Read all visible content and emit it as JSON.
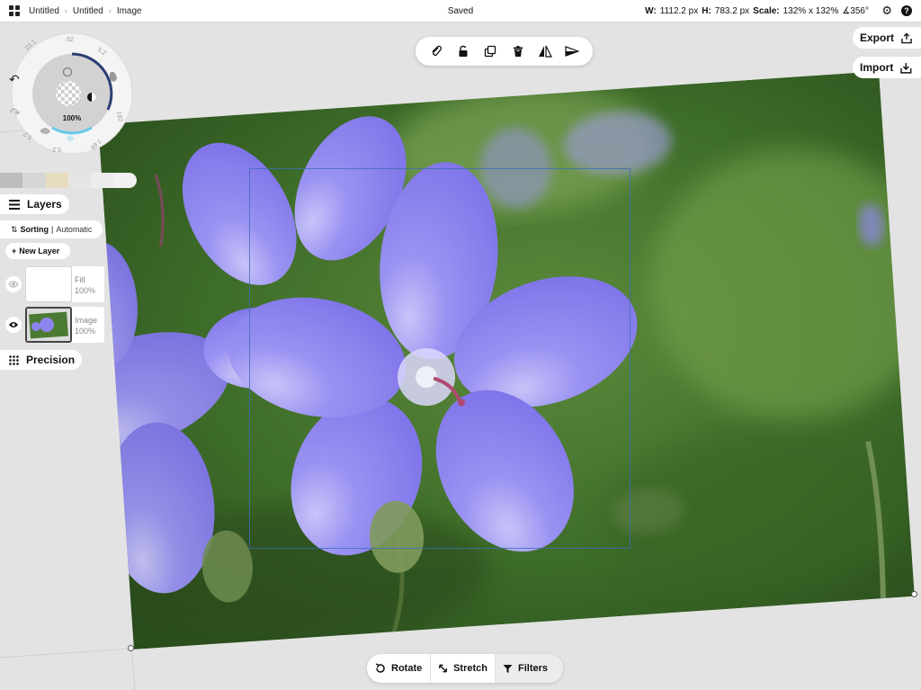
{
  "topbar": {
    "breadcrumbs": [
      "Untitled",
      "Untitled",
      "Image"
    ],
    "status": "Saved",
    "width_label": "W:",
    "width_value": "1112.2 px",
    "height_label": "H:",
    "height_value": "783.2 px",
    "scale_label": "Scale:",
    "scale_value": "132% x 132%",
    "angle_value": "∡356°",
    "icons": [
      "grid-icon",
      "gear-icon",
      "help-icon"
    ]
  },
  "toolbar": {
    "icons": [
      "paperclip-icon",
      "lock-icon",
      "duplicate-icon",
      "trash-icon",
      "flip-icon",
      "align-icon"
    ]
  },
  "actions": {
    "export_label": "Export",
    "import_label": "Import"
  },
  "brush": {
    "opacity": "100%",
    "sizes": [
      "23.1",
      ".52",
      "5.2",
      "192",
      "7.68",
      "5.2",
      "5.2"
    ]
  },
  "colors": {
    "swatches": [
      "#bdbdbd",
      "#d6d6d6",
      "#e8dcc0",
      "#e5e5e5",
      "#ececec",
      "#f1f1f1"
    ],
    "accent": "#111111",
    "flower": "#8d84ef"
  },
  "layers": {
    "title": "Layers",
    "sorting_label": "Sorting",
    "sorting_mode": "Automatic",
    "new_layer_label": "New Layer",
    "items": [
      {
        "name": "Fill",
        "opacity": "100%"
      },
      {
        "name": "Image",
        "opacity": "100%"
      }
    ]
  },
  "precision": {
    "title": "Precision"
  },
  "bottom": {
    "rotate_label": "Rotate",
    "stretch_label": "Stretch",
    "filters_label": "Filters"
  }
}
